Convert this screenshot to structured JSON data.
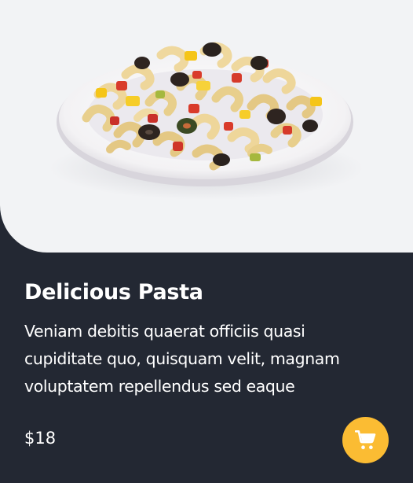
{
  "product": {
    "title": "Delicious Pasta",
    "description": "Veniam debitis quaerat officiis quasi cupiditate quo, quisquam velit, magnam voluptatem repellendus sed eaque",
    "price": "$18"
  },
  "image": {
    "subject": "bowl of macaroni pasta salad"
  },
  "cart_button": {
    "icon": "shopping-cart-icon"
  },
  "colors": {
    "card_background": "#232833",
    "image_background": "#f2f3f5",
    "accent": "#fbbc33",
    "text": "#ffffff"
  }
}
